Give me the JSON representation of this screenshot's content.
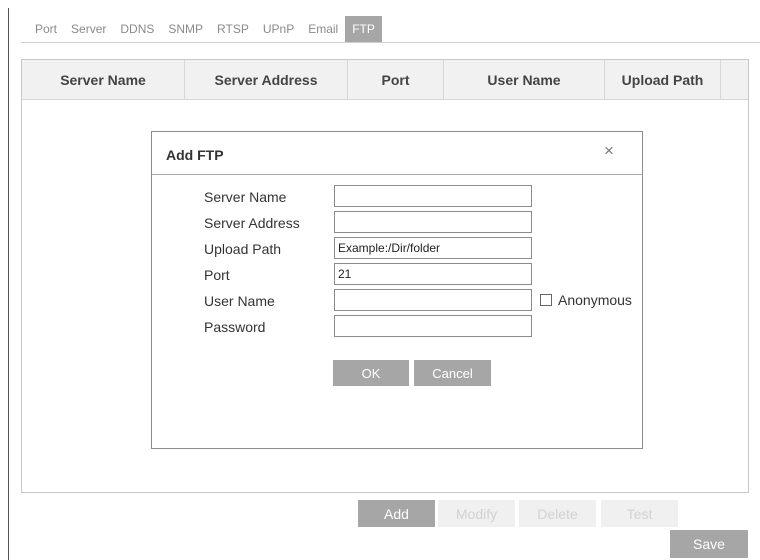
{
  "tabs": [
    {
      "label": "Port",
      "active": false
    },
    {
      "label": "Server",
      "active": false
    },
    {
      "label": "DDNS",
      "active": false
    },
    {
      "label": "SNMP",
      "active": false
    },
    {
      "label": "RTSP",
      "active": false
    },
    {
      "label": "UPnP",
      "active": false
    },
    {
      "label": "Email",
      "active": false
    },
    {
      "label": "FTP",
      "active": true
    }
  ],
  "table": {
    "columns": [
      "Server Name",
      "Server Address",
      "Port",
      "User Name",
      "Upload Path"
    ],
    "rows": []
  },
  "dialog": {
    "title": "Add FTP",
    "close_icon": "×",
    "fields": {
      "server_name": {
        "label": "Server Name",
        "value": ""
      },
      "server_address": {
        "label": "Server Address",
        "value": ""
      },
      "upload_path": {
        "label": "Upload Path",
        "value": "Example:/Dir/folder"
      },
      "port": {
        "label": "Port",
        "value": "21"
      },
      "user_name": {
        "label": "User Name",
        "value": ""
      },
      "password": {
        "label": "Password",
        "value": ""
      }
    },
    "anonymous": {
      "label": "Anonymous",
      "checked": false
    },
    "ok_label": "OK",
    "cancel_label": "Cancel"
  },
  "actions": {
    "add_label": "Add",
    "modify_label": "Modify",
    "delete_label": "Delete",
    "test_label": "Test",
    "save_label": "Save"
  },
  "colors": {
    "button_bg": "#a6a6a6",
    "disabled_bg": "#f0f0f0",
    "disabled_text": "#d2d2d2",
    "header_bg": "#f1f1f1"
  }
}
